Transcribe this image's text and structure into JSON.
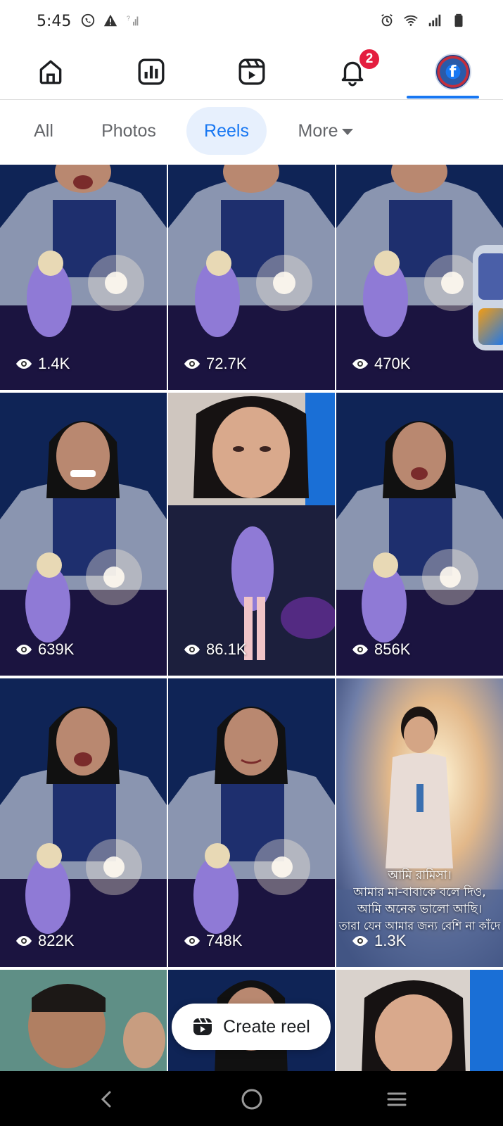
{
  "status_bar": {
    "time": "5:45",
    "left_icons": [
      "whatsapp-icon",
      "warning-icon",
      "no-sim-signal-icon"
    ],
    "right_icons": [
      "alarm-icon",
      "wifi-icon",
      "signal-icon",
      "battery-icon"
    ]
  },
  "top_nav": {
    "items": [
      {
        "name": "home",
        "icon": "home-icon"
      },
      {
        "name": "professional-dashboard",
        "icon": "chart-icon"
      },
      {
        "name": "reels",
        "icon": "reels-icon"
      },
      {
        "name": "notifications",
        "icon": "bell-icon",
        "badge": "2"
      },
      {
        "name": "profile",
        "icon": "avatar",
        "avatar_letter": "f",
        "active": true
      }
    ],
    "accent": "#1877f2"
  },
  "filters": {
    "tabs": [
      {
        "label": "All",
        "active": false
      },
      {
        "label": "Photos",
        "active": false
      },
      {
        "label": "Reels",
        "active": true
      },
      {
        "label": "More",
        "active": false,
        "has_dropdown": true
      }
    ]
  },
  "reels": {
    "tiles": [
      {
        "views": "1.4K"
      },
      {
        "views": "72.7K"
      },
      {
        "views": "470K"
      },
      {
        "views": "639K"
      },
      {
        "views": "86.1K"
      },
      {
        "views": "856K"
      },
      {
        "views": "822K"
      },
      {
        "views": "748K"
      },
      {
        "views": "1.3K",
        "caption_lines": [
          "আমি রামিসা।",
          "আমার মা-বাবাকে বলে দিও,",
          "আমি অনেক ভালো আছি।",
          "তারা যেন আমার জন্য বেশি না কাঁদে"
        ]
      },
      {
        "views": ""
      },
      {
        "views": ""
      },
      {
        "views": ""
      }
    ]
  },
  "create_reel": {
    "label": "Create reel",
    "icon": "reels-icon"
  },
  "system_nav": {
    "icons": [
      "back-icon",
      "home-circle-icon",
      "recents-icon"
    ]
  }
}
